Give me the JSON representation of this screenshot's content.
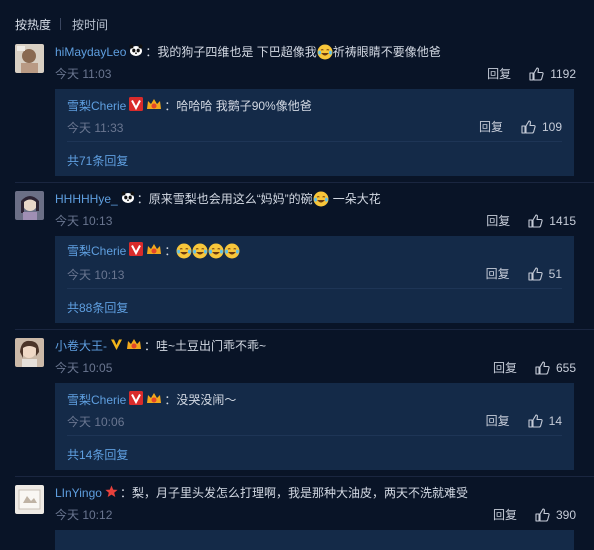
{
  "sort_tabs": [
    {
      "label": "按热度"
    },
    {
      "label": "按时间"
    }
  ],
  "comments": [
    {
      "user": "hiMaydayLeo",
      "text_before": "：我的狗子四维也是 下巴超像我",
      "text_after": "祈祷眼睛不要像他爸",
      "time": "今天 11:03",
      "reply_label": "回复",
      "likes": "1192",
      "sub": {
        "user": "雪梨Cherie",
        "text": "：哈哈哈 我鹅子90%像他爸",
        "time": "今天 11:33",
        "reply_label": "回复",
        "likes": "109",
        "more": "共71条回复"
      }
    },
    {
      "user": "HHHHHye_",
      "text_before": "：原来雪梨也会用这么“妈妈”的碗",
      "text_after": "一朵大花",
      "time": "今天 10:13",
      "reply_label": "回复",
      "likes": "1415",
      "sub": {
        "user": "雪梨Cherie",
        "text": "：",
        "time": "今天 10:13",
        "reply_label": "回复",
        "likes": "51",
        "more": "共88条回复"
      }
    },
    {
      "user": "小卷大王-",
      "text_before": "：哇~土豆出门乖不乖~",
      "time": "今天 10:05",
      "reply_label": "回复",
      "likes": "655",
      "sub": {
        "user": "雪梨Cherie",
        "text": "：没哭没闹～",
        "time": "今天 10:06",
        "reply_label": "回复",
        "likes": "14",
        "more": "共14条回复"
      }
    },
    {
      "user": "LInYingo",
      "text_before": "：梨，月子里头发怎么打理啊，我是那种大油皮，两天不洗就难受",
      "time": "今天 10:12",
      "reply_label": "回复",
      "likes": "390"
    }
  ],
  "icons": {
    "like": "thumbs-up-icon",
    "panda_badge": "panda-badge-icon",
    "verified": "verified-v-icon",
    "member": "member-crown-icon",
    "star": "star-badge-icon",
    "laugh": "laugh-cry-emoji"
  },
  "colors": {
    "background": "#091427",
    "reply_box": "#142a48",
    "username": "#5f9fe0",
    "text": "#d3d9e3",
    "meta": "#6a7690",
    "verified_v": "#d92b2b",
    "gold_v": "#f2b51b"
  }
}
